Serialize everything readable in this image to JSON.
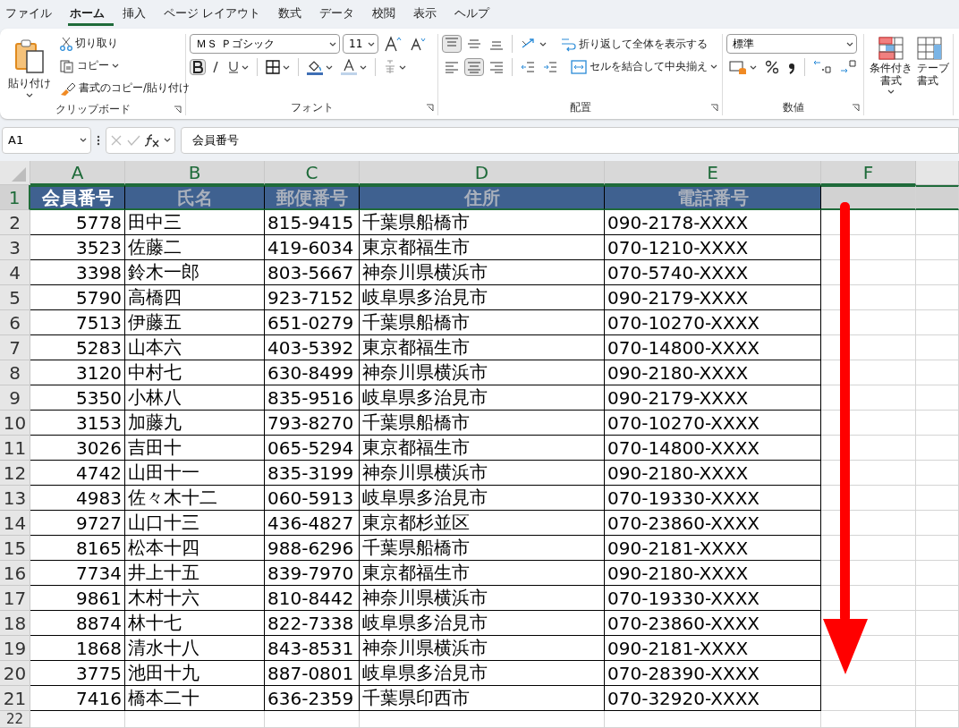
{
  "menu_tabs": [
    {
      "label": "ファイル",
      "selected": false
    },
    {
      "label": "ホーム",
      "selected": true
    },
    {
      "label": "挿入",
      "selected": false
    },
    {
      "label": "ページ レイアウト",
      "selected": false
    },
    {
      "label": "数式",
      "selected": false
    },
    {
      "label": "データ",
      "selected": false
    },
    {
      "label": "校閲",
      "selected": false
    },
    {
      "label": "表示",
      "selected": false
    },
    {
      "label": "ヘルプ",
      "selected": false
    }
  ],
  "ribbon": {
    "clipboard": {
      "paste": "貼り付け",
      "cut": "切り取り",
      "copy": "コピー",
      "format_painter": "書式のコピー/貼り付け",
      "label": "クリップボード"
    },
    "font": {
      "font_name": "ＭＳ Ｐゴシック",
      "font_size": "11",
      "bold": true,
      "label": "フォント"
    },
    "alignment": {
      "top_align": true,
      "center_align": true,
      "wrap_text": "折り返して全体を表示する",
      "merge_center": "セルを結合して中央揃え",
      "label": "配置"
    },
    "number": {
      "format": "標準",
      "label": "数値"
    },
    "styles": {
      "conditional_format": "条件付き書式",
      "table_format_line1": "テーブ",
      "table_format_line2": "書式"
    }
  },
  "formula_bar": {
    "name_box": "A1",
    "formula": "会員番号"
  },
  "sheet": {
    "columns": [
      {
        "label": "A"
      },
      {
        "label": "B"
      },
      {
        "label": "C"
      },
      {
        "label": "D"
      },
      {
        "label": "E"
      },
      {
        "label": "F"
      }
    ],
    "rows": [
      {
        "number": "1",
        "selected": true,
        "kind": "header",
        "cells": [
          "会員番号",
          "氏名",
          "郵便番号",
          "住所",
          "電話番号"
        ]
      },
      {
        "number": "2",
        "selected": false,
        "kind": "data",
        "cells": [
          "5778",
          "田中三",
          "815-9415",
          "千葉県船橋市",
          "090-2178-XXXX"
        ]
      },
      {
        "number": "3",
        "selected": false,
        "kind": "data",
        "cells": [
          "3523",
          "佐藤二",
          "419-6034",
          "東京都福生市",
          "070-1210-XXXX"
        ]
      },
      {
        "number": "4",
        "selected": false,
        "kind": "data",
        "cells": [
          "3398",
          "鈴木一郎",
          "803-5667",
          "神奈川県横浜市",
          "070-5740-XXXX"
        ]
      },
      {
        "number": "5",
        "selected": false,
        "kind": "data",
        "cells": [
          "5790",
          "高橋四",
          "923-7152",
          "岐阜県多治見市",
          "090-2179-XXXX"
        ]
      },
      {
        "number": "6",
        "selected": false,
        "kind": "data",
        "cells": [
          "7513",
          "伊藤五",
          "651-0279",
          "千葉県船橋市",
          "070-10270-XXXX"
        ]
      },
      {
        "number": "7",
        "selected": false,
        "kind": "data",
        "cells": [
          "5283",
          "山本六",
          "403-5392",
          "東京都福生市",
          "070-14800-XXXX"
        ]
      },
      {
        "number": "8",
        "selected": false,
        "kind": "data",
        "cells": [
          "3120",
          "中村七",
          "630-8499",
          "神奈川県横浜市",
          "090-2180-XXXX"
        ]
      },
      {
        "number": "9",
        "selected": false,
        "kind": "data",
        "cells": [
          "5350",
          "小林八",
          "835-9516",
          "岐阜県多治見市",
          "090-2179-XXXX"
        ]
      },
      {
        "number": "10",
        "selected": false,
        "kind": "data",
        "cells": [
          "3153",
          "加藤九",
          "793-8270",
          "千葉県船橋市",
          "070-10270-XXXX"
        ]
      },
      {
        "number": "11",
        "selected": false,
        "kind": "data",
        "cells": [
          "3026",
          "吉田十",
          "065-5294",
          "東京都福生市",
          "070-14800-XXXX"
        ]
      },
      {
        "number": "12",
        "selected": false,
        "kind": "data",
        "cells": [
          "4742",
          "山田十一",
          "835-3199",
          "神奈川県横浜市",
          "090-2180-XXXX"
        ]
      },
      {
        "number": "13",
        "selected": false,
        "kind": "data",
        "cells": [
          "4983",
          "佐々木十二",
          "060-5913",
          "岐阜県多治見市",
          "070-19330-XXXX"
        ]
      },
      {
        "number": "14",
        "selected": false,
        "kind": "data",
        "cells": [
          "9727",
          "山口十三",
          "436-4827",
          "東京都杉並区",
          "070-23860-XXXX"
        ]
      },
      {
        "number": "15",
        "selected": false,
        "kind": "data",
        "cells": [
          "8165",
          "松本十四",
          "988-6296",
          "千葉県船橋市",
          "090-2181-XXXX"
        ]
      },
      {
        "number": "16",
        "selected": false,
        "kind": "data",
        "cells": [
          "7734",
          "井上十五",
          "839-7970",
          "東京都福生市",
          "090-2180-XXXX"
        ]
      },
      {
        "number": "17",
        "selected": false,
        "kind": "data",
        "cells": [
          "9861",
          "木村十六",
          "810-8442",
          "神奈川県横浜市",
          "070-19330-XXXX"
        ]
      },
      {
        "number": "18",
        "selected": false,
        "kind": "data",
        "cells": [
          "8874",
          "林十七",
          "822-7338",
          "岐阜県多治見市",
          "070-23860-XXXX"
        ]
      },
      {
        "number": "19",
        "selected": false,
        "kind": "data",
        "cells": [
          "1868",
          "清水十八",
          "843-8531",
          "神奈川県横浜市",
          "090-2181-XXXX"
        ]
      },
      {
        "number": "20",
        "selected": false,
        "kind": "data",
        "cells": [
          "3775",
          "池田十九",
          "887-0801",
          "岐阜県多治見市",
          "070-28390-XXXX"
        ]
      },
      {
        "number": "21",
        "selected": false,
        "kind": "data",
        "cells": [
          "7416",
          "橋本二十",
          "636-2359",
          "千葉県印西市",
          "070-32920-XXXX"
        ]
      },
      {
        "number": "22",
        "selected": false,
        "kind": "empty",
        "cells": []
      }
    ],
    "annotations": [
      {
        "kind": "down-arrow",
        "color": "#ff0000"
      }
    ]
  }
}
